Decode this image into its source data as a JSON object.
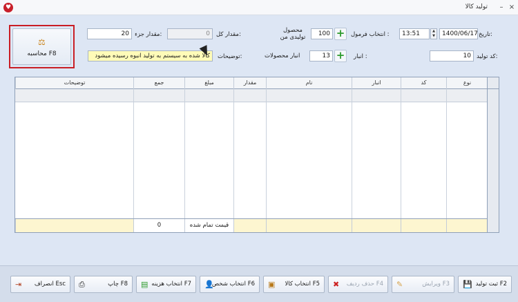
{
  "window": {
    "title": "تولید کالا",
    "minimize": "–",
    "close": "×",
    "app_icon": "heart-icon"
  },
  "form": {
    "date_label": "تاریخ:",
    "date_value": "1400/06/17",
    "time_value": "13:51",
    "formula_label": "انتخاب فرمول :",
    "product_qty_label": "محصول تولیدی من",
    "product_qty_value": "100",
    "total_qty_label": "مقدار کل:",
    "total_qty_value": "0",
    "part_qty_label": "مقدار جزء:",
    "part_qty_value": "20",
    "code_label": "کد تولید:",
    "code_value": "10",
    "warehouse_label": "انبار :",
    "product_wh_label": "انبار محصولات",
    "product_wh_value": "13",
    "desc_label": "توضیحات:",
    "desc_value": "کالا شده به سیستم به تولید انبوه رسیده میشود",
    "calc_button": "محاسبه F8"
  },
  "grid": {
    "columns": [
      "نوع",
      "کد",
      "انبار",
      "نام",
      "مقدار",
      "مبلغ",
      "جمع",
      "توضیحات"
    ],
    "totals": {
      "price_label": "قیمت تمام شده",
      "sum_value": "0"
    }
  },
  "actions": [
    {
      "name": "save-button",
      "label": "ثبت تولید F2",
      "icon": "save-icon"
    },
    {
      "name": "edit-button",
      "label": "ویرایش F3",
      "icon": "pencil-icon"
    },
    {
      "name": "delete-row-button",
      "label": "حذف ردیف F4",
      "icon": "x-icon"
    },
    {
      "name": "select-goods-button",
      "label": "انتخاب کالا F5",
      "icon": "box-icon"
    },
    {
      "name": "select-person-button",
      "label": "انتخاب شخص F6",
      "icon": "person-icon"
    },
    {
      "name": "select-expense-button",
      "label": "انتخاب هزینه F7",
      "icon": "money-icon"
    },
    {
      "name": "print-button",
      "label": "چاپ F8",
      "icon": "printer-icon"
    },
    {
      "name": "cancel-button",
      "label": "انصراف Esc",
      "icon": "exit-icon"
    }
  ],
  "colors": {
    "highlight_border": "#c91d24",
    "plus_green": "#2c9a2c"
  }
}
